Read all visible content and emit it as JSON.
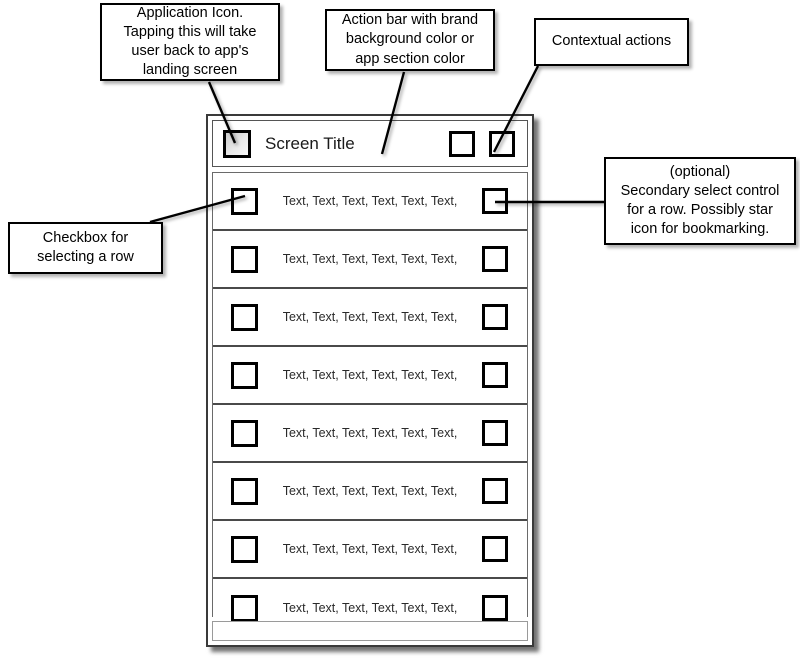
{
  "diagram": {
    "title": "Android action bar and list screen annotated wireframe",
    "colors": {
      "page_background": "#ffffff",
      "callout_border": "#000000",
      "device_border": "#3a3a3a",
      "control_border": "#000000",
      "text": "#000000"
    }
  },
  "callouts": [
    {
      "id": "application-icon",
      "lines": [
        "Application Icon.",
        "Tapping this will take",
        "user back to app's",
        "landing screen"
      ]
    },
    {
      "id": "action-bar",
      "lines": [
        "Action bar with brand",
        "background color or",
        "app section color"
      ]
    },
    {
      "id": "contextual-actions",
      "lines": [
        "Contextual actions"
      ]
    },
    {
      "id": "secondary-select",
      "lines": [
        "(optional)",
        "Secondary select control",
        "for a row. Possibly star",
        "icon for bookmarking."
      ]
    },
    {
      "id": "row-checkbox",
      "lines": [
        "Checkbox for",
        "selecting a row"
      ]
    }
  ],
  "device": {
    "action_bar": {
      "app_icon_name": "app-launcher-icon",
      "title": "Screen Title",
      "actions": [
        {
          "name": "contextual-action-1",
          "label": ""
        },
        {
          "name": "contextual-action-2",
          "label": ""
        }
      ]
    },
    "list": {
      "row_text": "Text, Text, Text, Text, Text, Text,",
      "rows": [
        {
          "text": "Text, Text, Text, Text, Text, Text,"
        },
        {
          "text": "Text, Text, Text, Text, Text, Text,"
        },
        {
          "text": "Text, Text, Text, Text, Text, Text,"
        },
        {
          "text": "Text, Text, Text, Text, Text, Text,"
        },
        {
          "text": "Text, Text, Text, Text, Text, Text,"
        },
        {
          "text": "Text, Text, Text, Text, Text, Text,"
        },
        {
          "text": "Text, Text, Text, Text, Text, Text,"
        },
        {
          "text": "Text, Text, Text, Text, Text, Text,"
        }
      ]
    }
  }
}
